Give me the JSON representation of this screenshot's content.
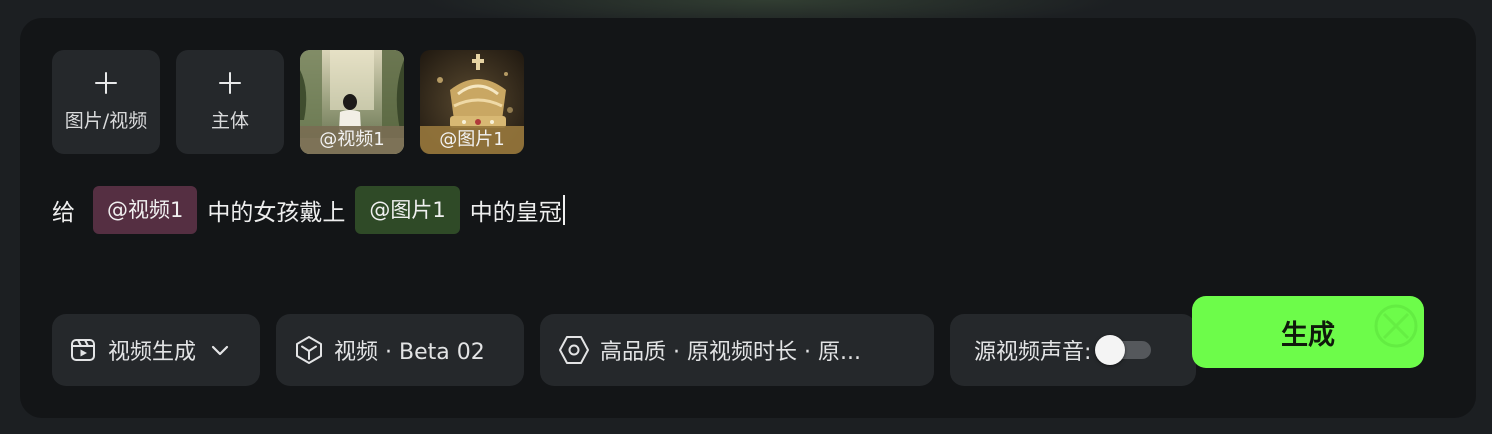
{
  "upload": {
    "media_label": "图片/视频",
    "subject_label": "主体"
  },
  "references": [
    {
      "tag": "@视频1",
      "kind": "video"
    },
    {
      "tag": "@图片1",
      "kind": "image"
    }
  ],
  "prompt": {
    "prefix": "给",
    "chip_video": "@视频1",
    "middle": "中的女孩戴上",
    "chip_image": "@图片1",
    "suffix": "中的皇冠"
  },
  "controls": {
    "mode_label": "视频生成",
    "model_label": "视频 · Beta 02",
    "settings_label": "高品质 · 原视频时长 · 原...",
    "source_audio_label": "源视频声音:",
    "source_audio_enabled": false
  },
  "generate_label": "生成",
  "colors": {
    "accent": "#6dfc4a",
    "video_chip": "#552f42",
    "image_chip": "#2f4a27"
  }
}
